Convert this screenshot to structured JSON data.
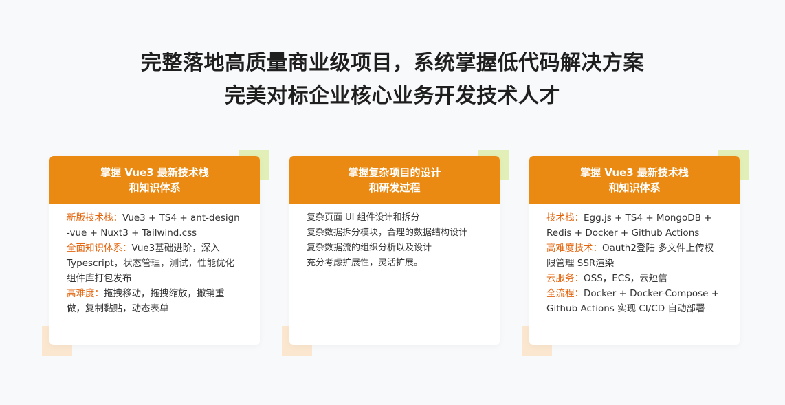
{
  "headline": {
    "line1": "完整落地高质量商业级项目，系统掌握低代码解决方案",
    "line2": "完美对标企业核心业务开发技术人才"
  },
  "colors": {
    "header": "#ea8a12",
    "highlight": "#e3660f",
    "deco_green": "#e2efb6",
    "deco_peach": "#fbe7cf"
  },
  "cards": [
    {
      "title1": "掌握 Vue3 最新技术栈",
      "title2": "和知识体系",
      "rows": [
        {
          "label": "新版技术栈：",
          "text": "Vue3 + TS4 + ant-design"
        },
        {
          "label": "",
          "text": "-vue + Nuxt3 + Tailwind.css"
        },
        {
          "label": "全面知识体系：",
          "text": "Vue3基础进阶，深入"
        },
        {
          "label": "",
          "text": "Typescript，状态管理，测试，性能优化"
        },
        {
          "label": "",
          "text": "组件库打包发布"
        },
        {
          "label": "高难度：",
          "text": "拖拽移动，拖拽缩放，撤销重"
        },
        {
          "label": "",
          "text": "做，复制黏贴，动态表单"
        }
      ]
    },
    {
      "title1": "掌握复杂项目的设计",
      "title2": "和研发过程",
      "rows": [
        {
          "label": "",
          "text": "复杂页面 UI 组件设计和拆分"
        },
        {
          "label": "",
          "text": "复杂数据拆分模块，合理的数据结构设计"
        },
        {
          "label": "",
          "text": "复杂数据流的组织分析以及设计"
        },
        {
          "label": "",
          "text": "充分考虑扩展性，灵活扩展。"
        }
      ]
    },
    {
      "title1": "掌握 Vue3 最新技术栈",
      "title2": "和知识体系",
      "rows": [
        {
          "label": "技术栈：",
          "text": "Egg.js + TS4 + MongoDB +"
        },
        {
          "label": "",
          "text": "Redis + Docker + Github Actions"
        },
        {
          "label": "高难度技术：",
          "text": "Oauth2登陆 多文件上传权"
        },
        {
          "label": "",
          "text": "限管理 SSR渲染"
        },
        {
          "label": "云服务：",
          "text": "OSS，ECS，云短信"
        },
        {
          "label": "全流程：",
          "text": "Docker + Docker-Compose +"
        },
        {
          "label": "",
          "text": "Github Actions 实现 CI/CD 自动部署"
        }
      ]
    }
  ]
}
